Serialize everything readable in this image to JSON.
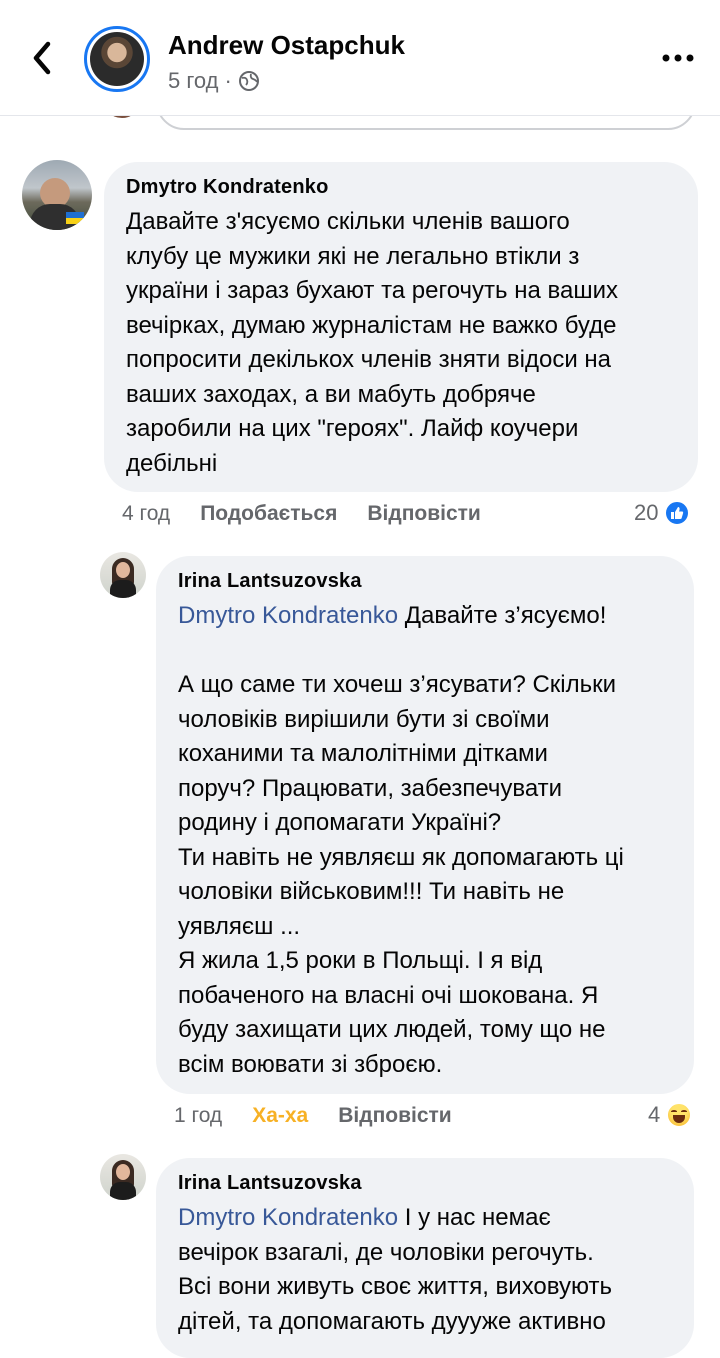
{
  "header": {
    "author_name": "Andrew Ostapchuk",
    "time": "5 год",
    "separator": "·",
    "back_icon": "chevron-left-icon",
    "more_icon": "more-horizontal-icon",
    "privacy_icon": "globe-icon",
    "accent_color": "#1877f2"
  },
  "comments": [
    {
      "author": "Dmytro Kondratenko",
      "text_lines": [
        "Давайте з'ясуємо скільки членів вашого",
        "клубу це мужики які не легально втікли з",
        "україни і зараз бухают та регочуть на ваших",
        "вечірках, думаю журналістам не важко буде",
        "попросити декількох членів зняти відоси на",
        "ваших заходах, а ви мабуть добряче",
        "заробили на цих \"героях\". Лайф коучери",
        "дебільні"
      ],
      "time": "4 год",
      "like_label": "Подобається",
      "reply_label": "Відповісти",
      "reaction_count": "20",
      "reaction_icon": "like-icon"
    },
    {
      "author": "Irina Lantsuzovska",
      "mention": "Dmytro Kondratenko",
      "text_first": " Давайте з’ясуємо!",
      "text_lines": [
        "А що саме ти хочеш  з’ясувати? Скільки",
        "чоловіків вирішили бути зі своїми",
        "коханими та малолітніми дітками",
        "поруч? Працювати, забезпечувати",
        "родину і допомагати Україні?",
        "Ти навіть не уявляєш як допомагають ці",
        "чоловіки військовим!!! Ти навіть не",
        "уявляєш ...",
        "Я жила 1,5 роки в Польщі. І я від",
        "побаченого на власні очі шокована. Я",
        "буду захищати цих людей, тому що не",
        "всім воювати зі зброєю."
      ],
      "time": "1 год",
      "like_label": "Ха-ха",
      "reply_label": "Відповісти",
      "reaction_count": "4",
      "reaction_icon": "haha-icon"
    },
    {
      "author": "Irina Lantsuzovska",
      "mention": "Dmytro Kondratenko",
      "text_first": " І у нас немає",
      "text_lines": [
        "вечірок взагалі, де чоловіки регочуть.",
        "Всі вони живуть своє життя, виховують",
        "дітей, та допомагають дуууже активно"
      ]
    }
  ]
}
